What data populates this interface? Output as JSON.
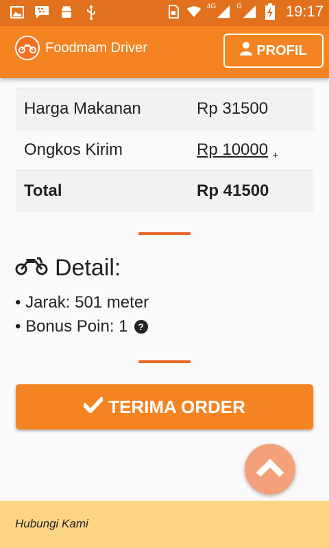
{
  "status_bar": {
    "icons_left": [
      "image-icon",
      "bbm-icon",
      "android-icon",
      "usb-icon"
    ],
    "network_4g": "4G",
    "network_g": "G",
    "time": "19:17"
  },
  "navbar": {
    "brand": "Foodmam Driver",
    "profil_label": "PROFIL"
  },
  "price_table": {
    "rows": [
      {
        "label": "Harga Makanan",
        "value": "Rp 31500"
      },
      {
        "label": "Ongkos Kirim",
        "value": "Rp 10000",
        "extra": "+"
      },
      {
        "label": "Total",
        "value": "Rp 41500"
      }
    ]
  },
  "detail": {
    "title": "Detail:",
    "jarak": "• Jarak: 501 meter",
    "bonus": "• Bonus Poin: 1",
    "help_icon": "?"
  },
  "action": {
    "terima_label": "TERIMA ORDER"
  },
  "footer": {
    "contact": "Hubungi Kami"
  },
  "colors": {
    "status_bar": "#e2711d",
    "primary": "#f48322",
    "divider": "#e8672a",
    "footer": "#fdd585",
    "scroll_button": "#f4a07a"
  }
}
